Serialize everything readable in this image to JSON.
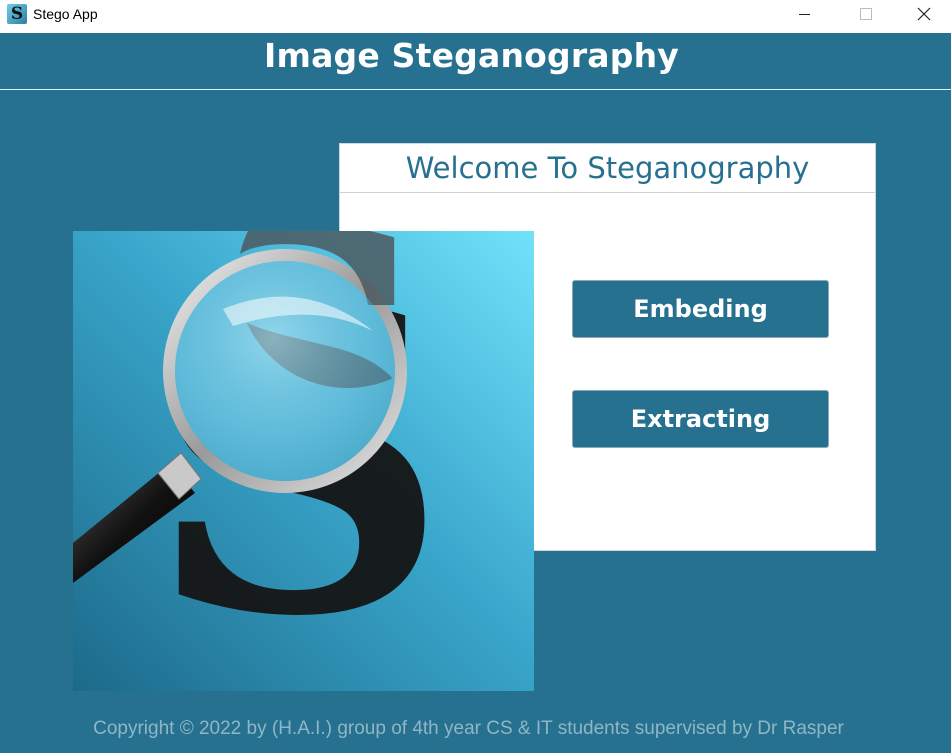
{
  "window": {
    "title": "Stego App",
    "icon": "stego-app-icon",
    "icon_letter": "S",
    "controls": [
      "minimize-icon",
      "maximize-icon",
      "close-icon"
    ]
  },
  "header": {
    "title": "Image Steganography"
  },
  "welcome": {
    "title": "Welcome To Steganography",
    "buttons": {
      "embed_label": "Embeding",
      "extract_label": "Extracting"
    }
  },
  "logo": {
    "icon": "magnifier-s-logo",
    "letter": "S"
  },
  "footer": {
    "text": "Copyright © 2022 by (H.A.I.) group of 4th year CS & IT students supervised by Dr Rasper"
  },
  "colors": {
    "background": "#26718f",
    "panel": "#ffffff",
    "accent": "#26718f",
    "footer_text": "#8fb6c6"
  }
}
